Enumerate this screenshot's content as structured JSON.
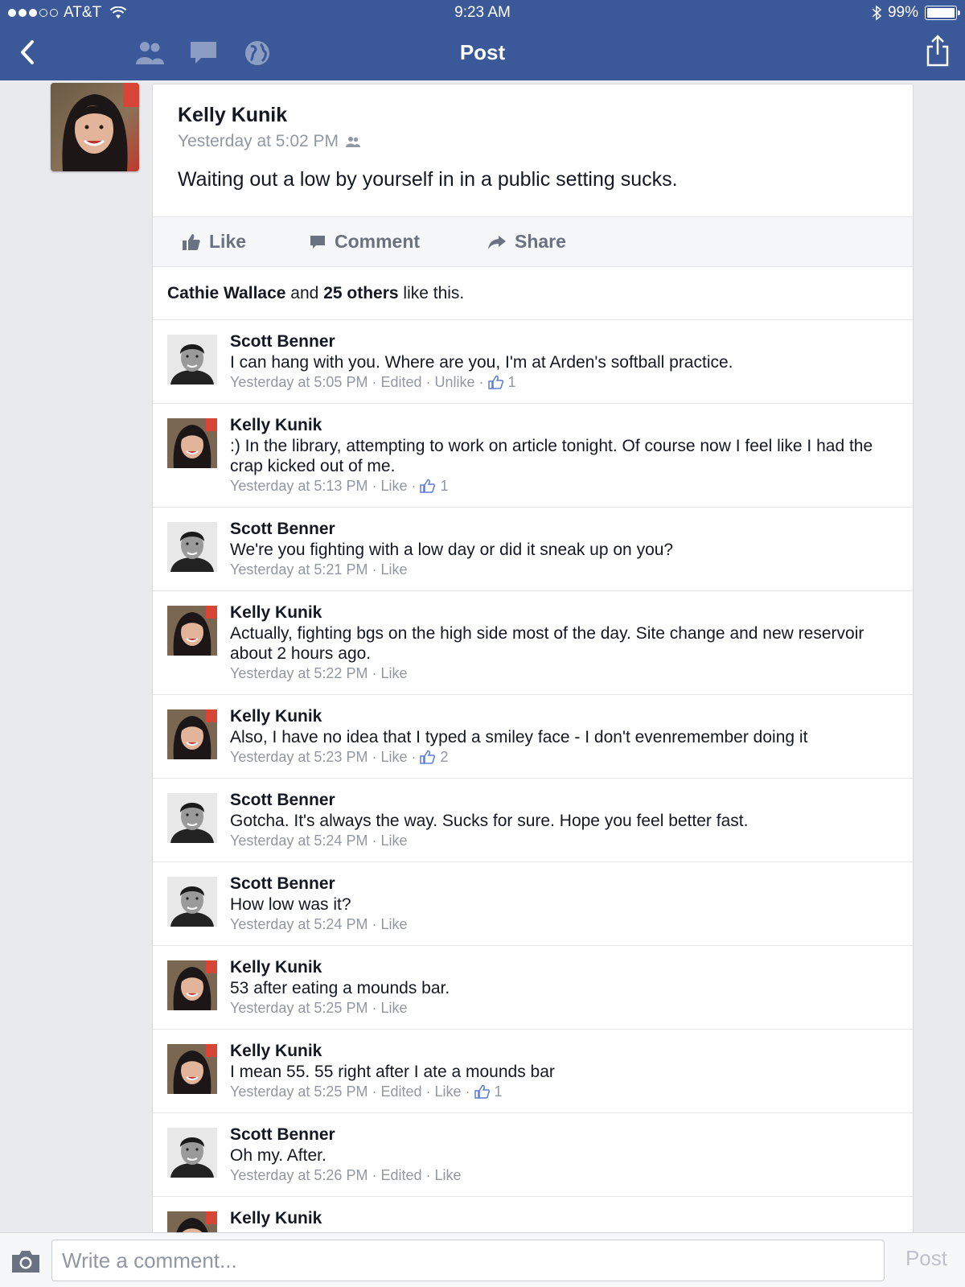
{
  "status_bar": {
    "carrier": "AT&T",
    "time": "9:23 AM",
    "battery": "99%",
    "battery_level": 0.99,
    "signal_bars_filled": 3,
    "signal_bars_total": 5
  },
  "nav": {
    "title": "Post",
    "icons": [
      "back-icon",
      "friends-icon",
      "messages-icon",
      "globe-icon",
      "share-out-icon"
    ]
  },
  "post": {
    "author": "Kelly Kunik",
    "time": "Yesterday at 5:02 PM",
    "text": "Waiting out a low by yourself in in a public setting sucks.",
    "actions": {
      "like": "Like",
      "comment": "Comment",
      "share": "Share"
    },
    "likes": {
      "name": "Cathie Wallace",
      "and": "and",
      "others": "25 others",
      "suffix": "like this."
    }
  },
  "comments": [
    {
      "author": "Scott Benner",
      "text": "I can hang with you. Where are you, I'm at Arden's softball practice.",
      "time": "Yesterday at 5:05 PM",
      "edited": "Edited",
      "action": "Unlike",
      "likes": "1"
    },
    {
      "author": "Kelly Kunik",
      "text": ":) In the library, attempting to work on article tonight. Of course now I feel like I had the crap kicked out of me.",
      "time": "Yesterday at 5:13 PM",
      "action": "Like",
      "likes": "1"
    },
    {
      "author": "Scott Benner",
      "text": "We're you fighting with a low day or did it sneak up on you?",
      "time": "Yesterday at 5:21 PM",
      "action": "Like"
    },
    {
      "author": "Kelly Kunik",
      "text": "Actually, fighting bgs on the high side most of the day. Site change and new reservoir about 2 hours ago.",
      "time": "Yesterday at 5:22 PM",
      "action": "Like"
    },
    {
      "author": "Kelly Kunik",
      "text": "Also, I have no idea that I typed a smiley face - I don't evenremember doing it",
      "time": "Yesterday at 5:23 PM",
      "action": "Like",
      "likes": "2"
    },
    {
      "author": "Scott Benner",
      "text": "Gotcha. It's always the way. Sucks for sure. Hope you feel better fast.",
      "time": "Yesterday at 5:24 PM",
      "action": "Like"
    },
    {
      "author": "Scott Benner",
      "text": "How low was it?",
      "time": "Yesterday at 5:24 PM",
      "action": "Like"
    },
    {
      "author": "Kelly Kunik",
      "text": "53 after eating a mounds bar.",
      "time": "Yesterday at 5:25 PM",
      "action": "Like"
    },
    {
      "author": "Kelly Kunik",
      "text": "I mean 55. 55 right after I ate a mounds bar",
      "time": "Yesterday at 5:25 PM",
      "edited": "Edited",
      "action": "Like",
      "likes": "1"
    },
    {
      "author": "Scott Benner",
      "text": "Oh my. After.",
      "time": "Yesterday at 5:26 PM",
      "edited": "Edited",
      "action": "Like"
    },
    {
      "author": "Kelly Kunik",
      "text": "",
      "time": ""
    }
  ],
  "composer": {
    "placeholder": "Write a comment...",
    "post_label": "Post"
  },
  "colors": {
    "brand": "#3b5998",
    "meta_gray": "#9197a3",
    "like_blue": "#5b7bd5"
  }
}
